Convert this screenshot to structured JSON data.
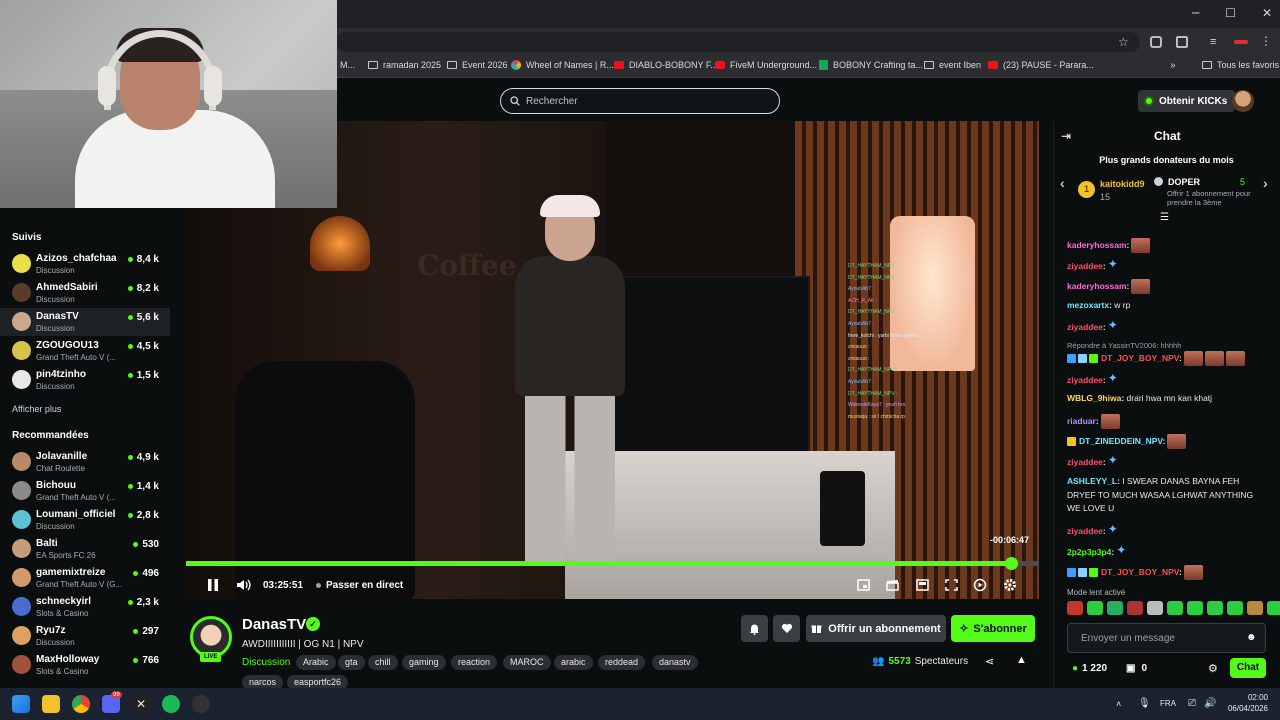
{
  "browser": {
    "bookmarks": [
      {
        "label": "M...",
        "icon": "folder-icon"
      },
      {
        "label": "ramadan 2025",
        "icon": "folder-icon"
      },
      {
        "label": "Event 2026",
        "icon": "folder-icon"
      },
      {
        "label": "Wheel of Names | R...",
        "icon": "wheel-icon"
      },
      {
        "label": "DIABLO-BOBONY F...",
        "icon": "youtube-icon"
      },
      {
        "label": "FiveM Underground...",
        "icon": "youtube-icon"
      },
      {
        "label": "BOBONY Crafting ta...",
        "icon": "sheets-icon"
      },
      {
        "label": "event Iben",
        "icon": "folder-icon"
      },
      {
        "label": "(23) PAUSE - Parara...",
        "icon": "youtube-icon"
      }
    ],
    "all_bookmarks": "Tous les favoris"
  },
  "header": {
    "search_placeholder": "Rechercher",
    "kicks_button": "Obtenir KICKs"
  },
  "sidebar": {
    "following_title": "Suivis",
    "following": [
      {
        "name": "Azizos_chafchaa",
        "category": "Discussion",
        "viewers": "8,4 k"
      },
      {
        "name": "AhmedSabiri",
        "category": "Discussion",
        "viewers": "8,2 k"
      },
      {
        "name": "DanasTV",
        "category": "Discussion",
        "viewers": "5,6 k"
      },
      {
        "name": "ZGOUGOU13",
        "category": "Grand Theft Auto V (...",
        "viewers": "4,5 k"
      },
      {
        "name": "pin4tzinho",
        "category": "Discussion",
        "viewers": "1,5 k"
      }
    ],
    "show_more": "Afficher plus",
    "recommended_title": "Recommandées",
    "recommended": [
      {
        "name": "Jolavanille",
        "category": "Chat Roulette",
        "viewers": "4,9 k"
      },
      {
        "name": "Bichouu",
        "category": "Grand Theft Auto V (...",
        "viewers": "1,4 k"
      },
      {
        "name": "Loumani_officiel",
        "category": "Discussion",
        "viewers": "2,8 k"
      },
      {
        "name": "Balti",
        "category": "EA Sports FC 26",
        "viewers": "530"
      },
      {
        "name": "gamemixtreize",
        "category": "Grand Theft Auto V (G...",
        "viewers": "496"
      },
      {
        "name": "schneckyirl",
        "category": "Slots & Casino",
        "viewers": "2,3 k"
      },
      {
        "name": "Ryu7z",
        "category": "Discussion",
        "viewers": "297"
      },
      {
        "name": "MaxHolloway",
        "category": "Slots & Casino",
        "viewers": "766"
      }
    ]
  },
  "player": {
    "progress": 0.972,
    "remaining": "-00:06:47",
    "time": "03:25:51",
    "go_live": "Passer en direct",
    "overlay_chat": [
      "DT_HAYTHAM_NPV :",
      "DT_HAYTHAM_NPV :",
      "AyoubAb7 :",
      "ACH_R_AF :",
      "DT_HAYTHAM_NPV :",
      "AyoubAb7 :",
      "frere_kolchi : yarbi tbana perma",
      "ziniaouo :",
      "ziniaouo :",
      "DT_HAYTHAM_NPV :",
      "AyoubAb7 :",
      "DT_HAYTHAM_NPV :",
      "WaleedeKaya7 : yeah bro",
      "mustaqa : sir l chmicha rp"
    ]
  },
  "channel": {
    "name": "DanasTV",
    "live": "LIVE",
    "title": "AWDIIIIIIIIIII | OG N1 | NPV",
    "category": "Discussion",
    "tags": [
      "Arabic",
      "gta",
      "chill",
      "gaming",
      "reaction",
      "MAROC",
      "arabic",
      "reddead",
      "danastv",
      "narcos",
      "easportfc26"
    ],
    "gift_button": "Offrir un abonnement",
    "subscribe_button": "S'abonner",
    "viewers_count": "5573",
    "viewers_label": "Spectateurs"
  },
  "chat": {
    "title": "Chat",
    "donors_title": "Plus grands donateurs du mois",
    "top_donor": {
      "rank": "1",
      "name": "kaitokidd9",
      "amount": "15"
    },
    "doper": {
      "name": "DOPER",
      "count": "5",
      "cta": "Offrir 1 abonnement pour prendre la 3ème"
    },
    "messages": [
      {
        "user": "kaderyhossam",
        "color": "#ff6ad5",
        "text": "",
        "emote": "face"
      },
      {
        "user": "ziyaddee",
        "color": "#ff4d6d",
        "text": "",
        "emote": "blue"
      },
      {
        "user": "kaderyhossam",
        "color": "#ff6ad5",
        "text": "",
        "emote": "face"
      },
      {
        "user": "mezoxartx",
        "color": "#6ee7ff",
        "text": "w rp",
        "emote": ""
      },
      {
        "user": "ziyaddee",
        "color": "#ff4d6d",
        "text": "",
        "emote": "blue"
      },
      {
        "user": "DT_JOY_BOY_NPV",
        "color": "#ff4d4d",
        "text": "",
        "emote": "faces3",
        "reply": "Répondre à YassinTV2006: hhhhh"
      },
      {
        "user": "ziyaddee",
        "color": "#ff4d6d",
        "text": "",
        "emote": "blue"
      },
      {
        "user": "WBLG_9hiwa",
        "color": "#ffd84d",
        "text": "drari hwa mn kan khatj",
        "emote": ""
      },
      {
        "user": "riaduar",
        "color": "#b58cff",
        "text": "",
        "emote": "face"
      },
      {
        "user": "DT_ZINEDDEIN_NPV",
        "color": "#6ee7ff",
        "text": "",
        "emote": "face"
      },
      {
        "user": "ziyaddee",
        "color": "#ff4d6d",
        "text": "",
        "emote": "blue"
      },
      {
        "user": "ASHLEYY_L",
        "color": "#6ee7ff",
        "text": "I SWEAR DANAS BAYNA FEH",
        "text2": "DRYEF TO MUCH WASAA LGHWAT ANYTHING",
        "text3": "WE LOVE U",
        "emote": ""
      },
      {
        "user": "ziyaddee",
        "color": "#ff4d6d",
        "text": "",
        "emote": "blue"
      },
      {
        "user": "2p2p3p3p4",
        "color": "#53fc18",
        "text": "",
        "emote": "blue"
      },
      {
        "user": "DT_JOY_BOY_NPV",
        "color": "#ff4d4d",
        "text": "",
        "emote": "face"
      }
    ],
    "slow_mode": "Mode lent activé",
    "input_placeholder": "Envoyer un message",
    "kicks": "1 220",
    "zero": "0",
    "send_button": "Chat"
  },
  "taskbar": {
    "lang": "FRA",
    "time": "02:00",
    "date": "06/04/2026",
    "badge": "99"
  },
  "colors": {
    "accent": "#53fc18",
    "background": "#0b0e0f"
  }
}
